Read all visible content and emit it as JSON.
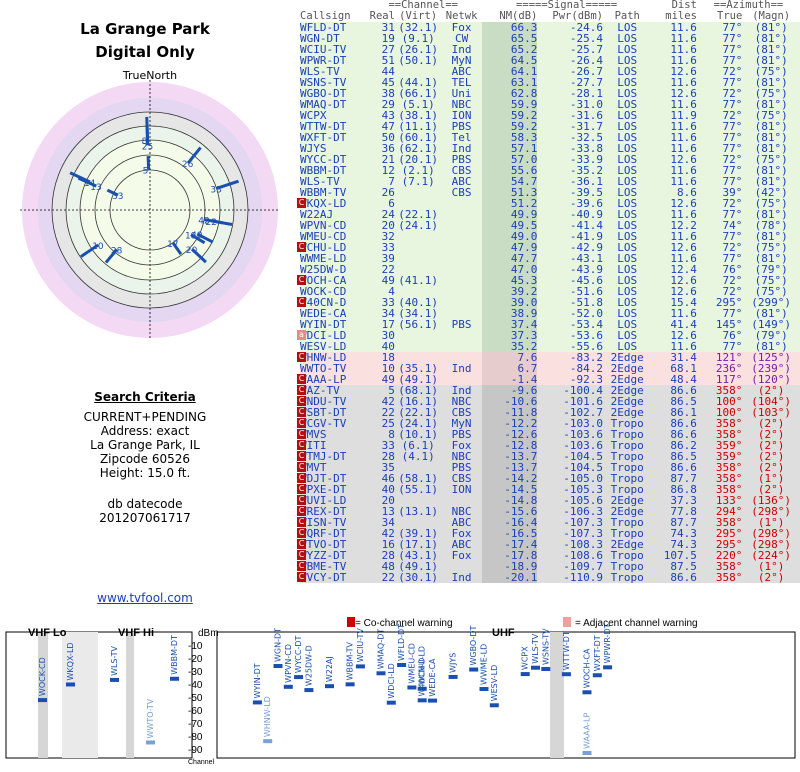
{
  "header": {
    "city": "La Grange Park",
    "subtitle": "Digital Only",
    "north_label": "TrueNorth"
  },
  "criteria": {
    "title": "Search Criteria",
    "lines": [
      "CURRENT+PENDING",
      "Address: exact",
      "La Grange Park, IL",
      "Zipcode 60526",
      "Height: 15.0 ft."
    ],
    "db_label": "db datecode",
    "db_value": "201207061717",
    "website": "www.tvfool.com"
  },
  "table": {
    "group_channel": "==Channel==",
    "group_signal": "=====Signal=====",
    "group_dist": "Dist",
    "group_azimuth": "==Azimuth==",
    "cols": [
      "Callsign",
      "Real",
      "(Virt)",
      "Netwk",
      "NM(dB)",
      "Pwr(dBm)",
      "Path",
      "miles",
      "True",
      "(Magn)"
    ],
    "rows": [
      [
        "WFLD-DT",
        "31",
        "(32.1)",
        "Fox",
        "66.3",
        "-24.6",
        "LOS",
        "11.6",
        "77°",
        "(81°)",
        "g",
        ""
      ],
      [
        "WGN-DT",
        "19",
        "(9.1)",
        "CW",
        "65.5",
        "-25.4",
        "LOS",
        "11.6",
        "77°",
        "(81°)",
        "g",
        ""
      ],
      [
        "WCIU-TV",
        "27",
        "(26.1)",
        "Ind",
        "65.2",
        "-25.7",
        "LOS",
        "11.6",
        "77°",
        "(81°)",
        "g",
        ""
      ],
      [
        "WPWR-DT",
        "51",
        "(50.1)",
        "MyN",
        "64.5",
        "-26.4",
        "LOS",
        "11.6",
        "77°",
        "(81°)",
        "g",
        ""
      ],
      [
        "WLS-TV",
        "44",
        "",
        "ABC",
        "64.1",
        "-26.7",
        "LOS",
        "12.6",
        "72°",
        "(75°)",
        "g",
        ""
      ],
      [
        "WSNS-TV",
        "45",
        "(44.1)",
        "TEL",
        "63.1",
        "-27.7",
        "LOS",
        "11.6",
        "77°",
        "(81°)",
        "g",
        ""
      ],
      [
        "WGBO-DT",
        "38",
        "(66.1)",
        "Uni",
        "62.8",
        "-28.1",
        "LOS",
        "12.6",
        "72°",
        "(75°)",
        "g",
        ""
      ],
      [
        "WMAQ-DT",
        "29",
        "(5.1)",
        "NBC",
        "59.9",
        "-31.0",
        "LOS",
        "11.6",
        "77°",
        "(81°)",
        "g",
        ""
      ],
      [
        "WCPX",
        "43",
        "(38.1)",
        "ION",
        "59.2",
        "-31.6",
        "LOS",
        "11.9",
        "72°",
        "(75°)",
        "g",
        ""
      ],
      [
        "WTTW-DT",
        "47",
        "(11.1)",
        "PBS",
        "59.2",
        "-31.7",
        "LOS",
        "11.6",
        "77°",
        "(81°)",
        "g",
        ""
      ],
      [
        "WXFT-DT",
        "50",
        "(60.1)",
        "Tel",
        "58.3",
        "-32.5",
        "LOS",
        "11.6",
        "77°",
        "(81°)",
        "g",
        ""
      ],
      [
        "WJYS",
        "36",
        "(62.1)",
        "Ind",
        "57.1",
        "-33.8",
        "LOS",
        "11.6",
        "77°",
        "(81°)",
        "g",
        ""
      ],
      [
        "WYCC-DT",
        "21",
        "(20.1)",
        "PBS",
        "57.0",
        "-33.9",
        "LOS",
        "12.6",
        "72°",
        "(75°)",
        "g",
        ""
      ],
      [
        "WBBM-DT",
        "12",
        "(2.1)",
        "CBS",
        "55.6",
        "-35.2",
        "LOS",
        "11.6",
        "77°",
        "(81°)",
        "g",
        ""
      ],
      [
        "WLS-TV",
        "7",
        "(7.1)",
        "ABC",
        "54.7",
        "-36.1",
        "LOS",
        "11.6",
        "77°",
        "(81°)",
        "g",
        ""
      ],
      [
        "WBBM-TV",
        "26",
        "",
        "CBS",
        "51.3",
        "-39.5",
        "LOS",
        "8.6",
        "39°",
        "(42°)",
        "g",
        ""
      ],
      [
        "WKQX-LD",
        "6",
        "",
        "",
        "51.2",
        "-39.6",
        "LOS",
        "12.6",
        "72°",
        "(75°)",
        "g",
        "C"
      ],
      [
        "W22AJ",
        "24",
        "(22.1)",
        "",
        "49.9",
        "-40.9",
        "LOS",
        "11.6",
        "77°",
        "(81°)",
        "g",
        ""
      ],
      [
        "WPVN-CD",
        "20",
        "(24.1)",
        "",
        "49.5",
        "-41.4",
        "LOS",
        "12.2",
        "74°",
        "(78°)",
        "g",
        ""
      ],
      [
        "WMEU-CD",
        "32",
        "",
        "",
        "49.0",
        "-41.9",
        "LOS",
        "11.6",
        "77°",
        "(81°)",
        "g",
        ""
      ],
      [
        "WCHU-LD",
        "33",
        "",
        "",
        "47.9",
        "-42.9",
        "LOS",
        "12.6",
        "72°",
        "(75°)",
        "g",
        "C"
      ],
      [
        "WWME-LD",
        "39",
        "",
        "",
        "47.7",
        "-43.1",
        "LOS",
        "11.6",
        "77°",
        "(81°)",
        "g",
        ""
      ],
      [
        "W25DW-D",
        "22",
        "",
        "",
        "47.0",
        "-43.9",
        "LOS",
        "12.4",
        "76°",
        "(79°)",
        "g",
        ""
      ],
      [
        "WOCH-CA",
        "49",
        "(41.1)",
        "",
        "45.3",
        "-45.6",
        "LOS",
        "12.6",
        "72°",
        "(75°)",
        "g",
        "C"
      ],
      [
        "WOCK-CD",
        "4",
        "",
        "",
        "39.2",
        "-51.6",
        "LOS",
        "12.6",
        "72°",
        "(75°)",
        "g",
        ""
      ],
      [
        "W40CN-D",
        "33",
        "(40.1)",
        "",
        "39.0",
        "-51.8",
        "LOS",
        "15.4",
        "295°",
        "(299°)",
        "g",
        "C"
      ],
      [
        "WEDE-CA",
        "34",
        "(34.1)",
        "",
        "38.9",
        "-52.0",
        "LOS",
        "11.6",
        "77°",
        "(81°)",
        "g",
        ""
      ],
      [
        "WYIN-DT",
        "17",
        "(56.1)",
        "PBS",
        "37.4",
        "-53.4",
        "LOS",
        "41.4",
        "145°",
        "(149°)",
        "g",
        ""
      ],
      [
        "WDCI-LD",
        "30",
        "",
        "",
        "37.3",
        "-53.6",
        "LOS",
        "12.6",
        "76°",
        "(79°)",
        "g",
        "a"
      ],
      [
        "WESV-LD",
        "40",
        "",
        "",
        "35.2",
        "-55.6",
        "LOS",
        "11.6",
        "77°",
        "(81°)",
        "g",
        ""
      ],
      [
        "WHNW-LD",
        "18",
        "",
        "",
        "7.6",
        "-83.2",
        "2Edge",
        "31.4",
        "121°",
        "(125°)",
        "p",
        "C"
      ],
      [
        "WWTO-TV",
        "10",
        "(35.1)",
        "Ind",
        "6.7",
        "-84.2",
        "2Edge",
        "68.1",
        "236°",
        "(239°)",
        "p",
        ""
      ],
      [
        "WAAA-LP",
        "49",
        "(49.1)",
        "",
        "-1.4",
        "-92.3",
        "2Edge",
        "48.4",
        "117°",
        "(120°)",
        "p",
        "aC"
      ],
      [
        "WAZ-TV",
        "5",
        "(68.1)",
        "Ind",
        "-9.6",
        "-100.4",
        "2Edge",
        "86.6",
        "358°",
        "(2°)",
        "r",
        "C"
      ],
      [
        "WNDU-TV",
        "42",
        "(16.1)",
        "NBC",
        "-10.6",
        "-101.6",
        "2Edge",
        "86.5",
        "100°",
        "(104°)",
        "r",
        "C"
      ],
      [
        "WSBT-DT",
        "22",
        "(22.1)",
        "CBS",
        "-11.8",
        "-102.7",
        "2Edge",
        "86.1",
        "100°",
        "(103°)",
        "r",
        "C"
      ],
      [
        "WCGV-TV",
        "25",
        "(24.1)",
        "MyN",
        "-12.2",
        "-103.0",
        "Tropo",
        "86.6",
        "358°",
        "(2°)",
        "r",
        "C"
      ],
      [
        "WMVS",
        "8",
        "(10.1)",
        "PBS",
        "-12.6",
        "-103.6",
        "Tropo",
        "86.6",
        "358°",
        "(2°)",
        "r",
        "C"
      ],
      [
        "WITI",
        "33",
        "(6.1)",
        "Fox",
        "-12.8",
        "-103.6",
        "Tropo",
        "86.2",
        "359°",
        "(2°)",
        "r",
        "C"
      ],
      [
        "WTMJ-DT",
        "28",
        "(4.1)",
        "NBC",
        "-13.7",
        "-104.5",
        "Tropo",
        "86.5",
        "359°",
        "(2°)",
        "r",
        "C"
      ],
      [
        "WMVT",
        "35",
        "",
        "PBS",
        "-13.7",
        "-104.5",
        "Tropo",
        "86.6",
        "358°",
        "(2°)",
        "r",
        "C"
      ],
      [
        "WDJT-DT",
        "46",
        "(58.1)",
        "CBS",
        "-14.2",
        "-105.0",
        "Tropo",
        "87.7",
        "358°",
        "(1°)",
        "r",
        "C"
      ],
      [
        "WPXE-DT",
        "40",
        "(55.1)",
        "ION",
        "-14.5",
        "-105.3",
        "Tropo",
        "86.8",
        "358°",
        "(2°)",
        "r",
        "C"
      ],
      [
        "WUVI-LD",
        "20",
        "",
        "",
        "-14.8",
        "-105.6",
        "2Edge",
        "37.3",
        "133°",
        "(136°)",
        "r",
        "C"
      ],
      [
        "WREX-DT",
        "13",
        "(13.1)",
        "NBC",
        "-15.6",
        "-106.3",
        "2Edge",
        "77.8",
        "294°",
        "(298°)",
        "r",
        "C"
      ],
      [
        "WISN-TV",
        "34",
        "",
        "ABC",
        "-16.4",
        "-107.3",
        "Tropo",
        "87.7",
        "358°",
        "(1°)",
        "r",
        "C"
      ],
      [
        "WQRF-DT",
        "42",
        "(39.1)",
        "Fox",
        "-16.5",
        "-107.3",
        "Tropo",
        "74.3",
        "295°",
        "(298°)",
        "r",
        "C"
      ],
      [
        "WTVO-DT",
        "16",
        "(17.1)",
        "ABC",
        "-17.4",
        "-108.3",
        "2Edge",
        "74.3",
        "295°",
        "(298°)",
        "r",
        "C"
      ],
      [
        "WYZZ-DT",
        "28",
        "(43.1)",
        "Fox",
        "-17.8",
        "-108.6",
        "Tropo",
        "107.5",
        "220°",
        "(224°)",
        "r",
        "C"
      ],
      [
        "WBME-TV",
        "48",
        "(49.1)",
        "",
        "-18.9",
        "-109.7",
        "Tropo",
        "87.5",
        "358°",
        "(1°)",
        "r",
        "C"
      ],
      [
        "WVCY-DT",
        "22",
        "(30.1)",
        "Ind",
        "-20.1",
        "-110.9",
        "Tropo",
        "86.6",
        "358°",
        "(2°)",
        "r",
        "C"
      ]
    ]
  },
  "polar": {
    "stations": [
      {
        "label": "26",
        "az": 39,
        "len": 0.82
      },
      {
        "label": "33",
        "az": 72,
        "len": 0.95
      },
      {
        "label": "5",
        "az": 358,
        "len": 0.55
      },
      {
        "label": "8",
        "az": 358,
        "len": 0.95
      },
      {
        "label": "25",
        "az": 358,
        "len": 0.88
      },
      {
        "label": "13",
        "az": 294,
        "len": 0.8
      },
      {
        "label": "14",
        "az": 295,
        "len": 0.9
      },
      {
        "label": "33",
        "az": 295,
        "len": 0.48
      },
      {
        "label": "10",
        "az": 236,
        "len": 0.85
      },
      {
        "label": "28",
        "az": 220,
        "len": 0.7
      },
      {
        "label": "17",
        "az": 145,
        "len": 0.55
      },
      {
        "label": "18",
        "az": 121,
        "len": 0.65
      },
      {
        "label": "49",
        "az": 117,
        "len": 0.72
      },
      {
        "label": "20",
        "az": 133,
        "len": 0.78
      },
      {
        "label": "42",
        "az": 100,
        "len": 0.75
      },
      {
        "label": "22",
        "az": 100,
        "len": 0.85
      }
    ]
  },
  "bottom": {
    "vhf_lo": "VHF Lo",
    "vhf_hi": "VHF Hi",
    "uhf": "UHF",
    "dbm": "dBm",
    "legend_co": "= Co-channel warning",
    "legend_adj": "= Adjacent channel warning",
    "channel_label": "Channel",
    "ylabels": [
      "-10",
      "-20",
      "-30",
      "-40",
      "-50",
      "-60",
      "-70",
      "-80",
      "-90"
    ]
  }
}
